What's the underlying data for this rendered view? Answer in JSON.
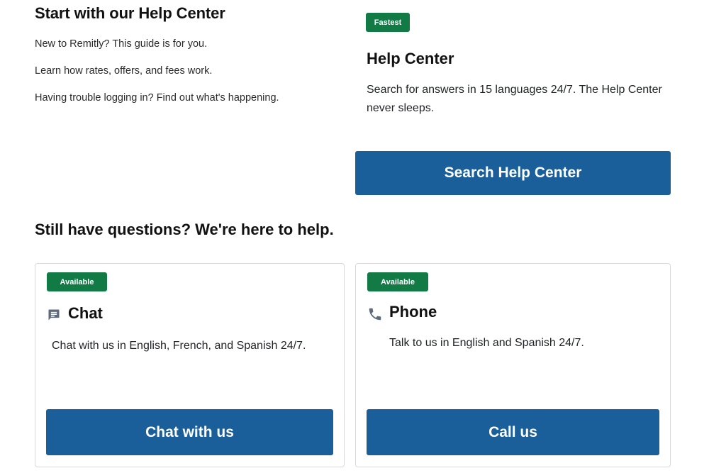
{
  "help_intro": {
    "title": "Start with our Help Center",
    "links": [
      "New to Remitly? This guide is for you.",
      "Learn how rates, offers, and fees work.",
      "Having trouble logging in? Find out what's happening."
    ]
  },
  "help_center": {
    "badge": "Fastest",
    "title": "Help Center",
    "description": "Search for answers in 15 languages 24/7. The Help Center never sleeps.",
    "button_label": "Search Help Center"
  },
  "contact": {
    "title": "Still have questions? We're here to help.",
    "chat": {
      "badge": "Available",
      "icon": "chat-icon",
      "title": "Chat",
      "description": "Chat with us in English, French, and Spanish 24/7.",
      "button_label": "Chat with us"
    },
    "phone": {
      "badge": "Available",
      "icon": "phone-icon",
      "title": "Phone",
      "description": "Talk to us in English and Spanish 24/7.",
      "button_label": "Call us"
    }
  },
  "colors": {
    "badge_green": "#117a45",
    "button_blue": "#1a5e9a",
    "icon_gray": "#5f6b7a"
  }
}
